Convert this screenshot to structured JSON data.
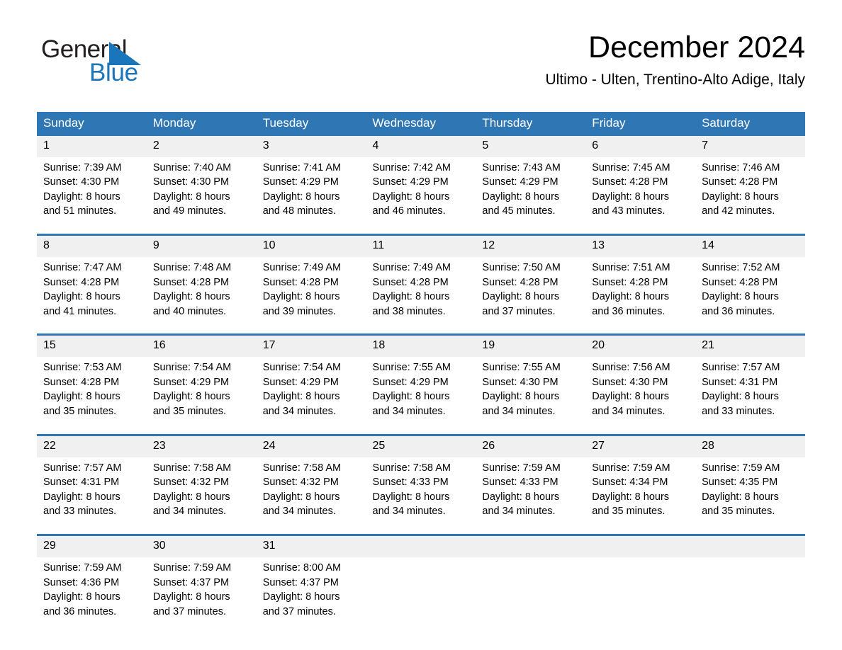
{
  "brand": {
    "name_top": "General",
    "name_bottom": "Blue",
    "accent_color": "#1b75bb"
  },
  "header": {
    "title": "December 2024",
    "location": "Ultimo - Ulten, Trentino-Alto Adige, Italy"
  },
  "theme": {
    "header_blue": "#2f76b5",
    "daynum_gray": "#f0f0f0",
    "text_black": "#000000"
  },
  "calendar": {
    "weekday_headers": [
      "Sunday",
      "Monday",
      "Tuesday",
      "Wednesday",
      "Thursday",
      "Friday",
      "Saturday"
    ],
    "weeks": [
      [
        {
          "day": "1",
          "sunrise": "Sunrise: 7:39 AM",
          "sunset": "Sunset: 4:30 PM",
          "daylight_line1": "Daylight: 8 hours",
          "daylight_line2": "and 51 minutes."
        },
        {
          "day": "2",
          "sunrise": "Sunrise: 7:40 AM",
          "sunset": "Sunset: 4:30 PM",
          "daylight_line1": "Daylight: 8 hours",
          "daylight_line2": "and 49 minutes."
        },
        {
          "day": "3",
          "sunrise": "Sunrise: 7:41 AM",
          "sunset": "Sunset: 4:29 PM",
          "daylight_line1": "Daylight: 8 hours",
          "daylight_line2": "and 48 minutes."
        },
        {
          "day": "4",
          "sunrise": "Sunrise: 7:42 AM",
          "sunset": "Sunset: 4:29 PM",
          "daylight_line1": "Daylight: 8 hours",
          "daylight_line2": "and 46 minutes."
        },
        {
          "day": "5",
          "sunrise": "Sunrise: 7:43 AM",
          "sunset": "Sunset: 4:29 PM",
          "daylight_line1": "Daylight: 8 hours",
          "daylight_line2": "and 45 minutes."
        },
        {
          "day": "6",
          "sunrise": "Sunrise: 7:45 AM",
          "sunset": "Sunset: 4:28 PM",
          "daylight_line1": "Daylight: 8 hours",
          "daylight_line2": "and 43 minutes."
        },
        {
          "day": "7",
          "sunrise": "Sunrise: 7:46 AM",
          "sunset": "Sunset: 4:28 PM",
          "daylight_line1": "Daylight: 8 hours",
          "daylight_line2": "and 42 minutes."
        }
      ],
      [
        {
          "day": "8",
          "sunrise": "Sunrise: 7:47 AM",
          "sunset": "Sunset: 4:28 PM",
          "daylight_line1": "Daylight: 8 hours",
          "daylight_line2": "and 41 minutes."
        },
        {
          "day": "9",
          "sunrise": "Sunrise: 7:48 AM",
          "sunset": "Sunset: 4:28 PM",
          "daylight_line1": "Daylight: 8 hours",
          "daylight_line2": "and 40 minutes."
        },
        {
          "day": "10",
          "sunrise": "Sunrise: 7:49 AM",
          "sunset": "Sunset: 4:28 PM",
          "daylight_line1": "Daylight: 8 hours",
          "daylight_line2": "and 39 minutes."
        },
        {
          "day": "11",
          "sunrise": "Sunrise: 7:49 AM",
          "sunset": "Sunset: 4:28 PM",
          "daylight_line1": "Daylight: 8 hours",
          "daylight_line2": "and 38 minutes."
        },
        {
          "day": "12",
          "sunrise": "Sunrise: 7:50 AM",
          "sunset": "Sunset: 4:28 PM",
          "daylight_line1": "Daylight: 8 hours",
          "daylight_line2": "and 37 minutes."
        },
        {
          "day": "13",
          "sunrise": "Sunrise: 7:51 AM",
          "sunset": "Sunset: 4:28 PM",
          "daylight_line1": "Daylight: 8 hours",
          "daylight_line2": "and 36 minutes."
        },
        {
          "day": "14",
          "sunrise": "Sunrise: 7:52 AM",
          "sunset": "Sunset: 4:28 PM",
          "daylight_line1": "Daylight: 8 hours",
          "daylight_line2": "and 36 minutes."
        }
      ],
      [
        {
          "day": "15",
          "sunrise": "Sunrise: 7:53 AM",
          "sunset": "Sunset: 4:28 PM",
          "daylight_line1": "Daylight: 8 hours",
          "daylight_line2": "and 35 minutes."
        },
        {
          "day": "16",
          "sunrise": "Sunrise: 7:54 AM",
          "sunset": "Sunset: 4:29 PM",
          "daylight_line1": "Daylight: 8 hours",
          "daylight_line2": "and 35 minutes."
        },
        {
          "day": "17",
          "sunrise": "Sunrise: 7:54 AM",
          "sunset": "Sunset: 4:29 PM",
          "daylight_line1": "Daylight: 8 hours",
          "daylight_line2": "and 34 minutes."
        },
        {
          "day": "18",
          "sunrise": "Sunrise: 7:55 AM",
          "sunset": "Sunset: 4:29 PM",
          "daylight_line1": "Daylight: 8 hours",
          "daylight_line2": "and 34 minutes."
        },
        {
          "day": "19",
          "sunrise": "Sunrise: 7:55 AM",
          "sunset": "Sunset: 4:30 PM",
          "daylight_line1": "Daylight: 8 hours",
          "daylight_line2": "and 34 minutes."
        },
        {
          "day": "20",
          "sunrise": "Sunrise: 7:56 AM",
          "sunset": "Sunset: 4:30 PM",
          "daylight_line1": "Daylight: 8 hours",
          "daylight_line2": "and 34 minutes."
        },
        {
          "day": "21",
          "sunrise": "Sunrise: 7:57 AM",
          "sunset": "Sunset: 4:31 PM",
          "daylight_line1": "Daylight: 8 hours",
          "daylight_line2": "and 33 minutes."
        }
      ],
      [
        {
          "day": "22",
          "sunrise": "Sunrise: 7:57 AM",
          "sunset": "Sunset: 4:31 PM",
          "daylight_line1": "Daylight: 8 hours",
          "daylight_line2": "and 33 minutes."
        },
        {
          "day": "23",
          "sunrise": "Sunrise: 7:58 AM",
          "sunset": "Sunset: 4:32 PM",
          "daylight_line1": "Daylight: 8 hours",
          "daylight_line2": "and 34 minutes."
        },
        {
          "day": "24",
          "sunrise": "Sunrise: 7:58 AM",
          "sunset": "Sunset: 4:32 PM",
          "daylight_line1": "Daylight: 8 hours",
          "daylight_line2": "and 34 minutes."
        },
        {
          "day": "25",
          "sunrise": "Sunrise: 7:58 AM",
          "sunset": "Sunset: 4:33 PM",
          "daylight_line1": "Daylight: 8 hours",
          "daylight_line2": "and 34 minutes."
        },
        {
          "day": "26",
          "sunrise": "Sunrise: 7:59 AM",
          "sunset": "Sunset: 4:33 PM",
          "daylight_line1": "Daylight: 8 hours",
          "daylight_line2": "and 34 minutes."
        },
        {
          "day": "27",
          "sunrise": "Sunrise: 7:59 AM",
          "sunset": "Sunset: 4:34 PM",
          "daylight_line1": "Daylight: 8 hours",
          "daylight_line2": "and 35 minutes."
        },
        {
          "day": "28",
          "sunrise": "Sunrise: 7:59 AM",
          "sunset": "Sunset: 4:35 PM",
          "daylight_line1": "Daylight: 8 hours",
          "daylight_line2": "and 35 minutes."
        }
      ],
      [
        {
          "day": "29",
          "sunrise": "Sunrise: 7:59 AM",
          "sunset": "Sunset: 4:36 PM",
          "daylight_line1": "Daylight: 8 hours",
          "daylight_line2": "and 36 minutes."
        },
        {
          "day": "30",
          "sunrise": "Sunrise: 7:59 AM",
          "sunset": "Sunset: 4:37 PM",
          "daylight_line1": "Daylight: 8 hours",
          "daylight_line2": "and 37 minutes."
        },
        {
          "day": "31",
          "sunrise": "Sunrise: 8:00 AM",
          "sunset": "Sunset: 4:37 PM",
          "daylight_line1": "Daylight: 8 hours",
          "daylight_line2": "and 37 minutes."
        },
        {
          "day": "",
          "sunrise": "",
          "sunset": "",
          "daylight_line1": "",
          "daylight_line2": ""
        },
        {
          "day": "",
          "sunrise": "",
          "sunset": "",
          "daylight_line1": "",
          "daylight_line2": ""
        },
        {
          "day": "",
          "sunrise": "",
          "sunset": "",
          "daylight_line1": "",
          "daylight_line2": ""
        },
        {
          "day": "",
          "sunrise": "",
          "sunset": "",
          "daylight_line1": "",
          "daylight_line2": ""
        }
      ]
    ]
  }
}
